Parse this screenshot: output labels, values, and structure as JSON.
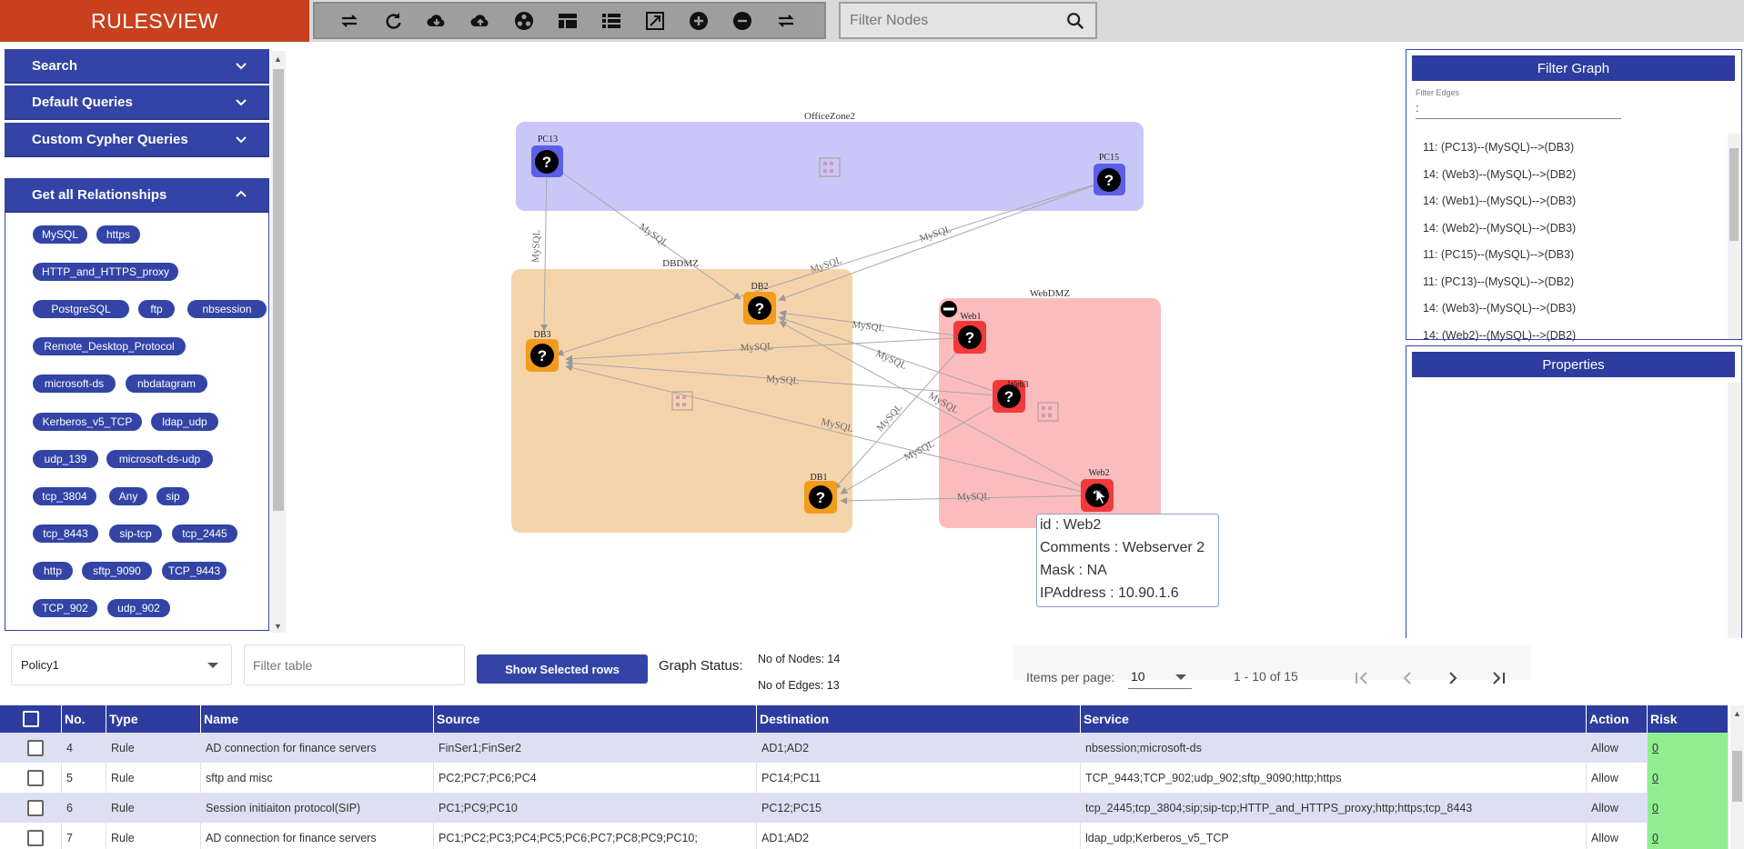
{
  "app": {
    "title": "RULESVIEW"
  },
  "toolbar": {
    "icons": [
      "swap-horizontal-icon",
      "refresh-icon",
      "cloud-download-icon",
      "cloud-upload-icon",
      "cluster-icon",
      "table-layout-icon",
      "list-icon",
      "fullscreen-icon",
      "zoom-in-icon",
      "zoom-out-icon",
      "swap-icon"
    ]
  },
  "filter_nodes": {
    "placeholder": "Filter Nodes"
  },
  "sidebar": {
    "sections": [
      {
        "label": "Search"
      },
      {
        "label": "Default Queries"
      },
      {
        "label": "Custom Cypher Queries"
      },
      {
        "label": "Get all Relationships"
      }
    ],
    "relationships": [
      "MySQL",
      "https",
      "HTTP_and_HTTPS_proxy",
      "PostgreSQL",
      "ftp",
      "nbsession",
      "Remote_Desktop_Protocol",
      "microsoft-ds",
      "nbdatagram",
      "Kerberos_v5_TCP",
      "ldap_udp",
      "udp_139",
      "microsoft-ds-udp",
      "tcp_3804",
      "Any",
      "sip",
      "tcp_8443",
      "sip-tcp",
      "tcp_2445",
      "http",
      "sftp_9090",
      "TCP_9443",
      "TCP_902",
      "udp_902"
    ]
  },
  "graph": {
    "zones": [
      {
        "name": "OfficeZone2"
      },
      {
        "name": "DBDMZ"
      },
      {
        "name": "WebDMZ"
      }
    ],
    "nodes": [
      {
        "id": "PC13"
      },
      {
        "id": "PC15"
      },
      {
        "id": "DB2"
      },
      {
        "id": "DB3"
      },
      {
        "id": "DB1"
      },
      {
        "id": "Web1"
      },
      {
        "id": "Web3"
      },
      {
        "id": "Web2"
      }
    ],
    "edge_label": "MySQL",
    "tooltip": {
      "id": "id : Web2",
      "comments": "Comments : Webserver 2",
      "mask": "Mask : NA",
      "ip": "IPAddress : 10.90.1.6"
    }
  },
  "filter_graph": {
    "title": "Filter Graph",
    "edges_label": "Filter Edges",
    "edges_value": ":",
    "items": [
      "11: (PC13)--(MySQL)-->(DB3)",
      "14: (Web3)--(MySQL)-->(DB2)",
      "14: (Web1)--(MySQL)-->(DB3)",
      "14: (Web2)--(MySQL)-->(DB3)",
      "11: (PC15)--(MySQL)-->(DB3)",
      "11: (PC13)--(MySQL)-->(DB2)",
      "14: (Web3)--(MySQL)-->(DB3)",
      "14: (Web2)--(MySQL)-->(DB2)"
    ]
  },
  "properties": {
    "title": "Properties"
  },
  "controls": {
    "policy": "Policy1",
    "filter_table_placeholder": "Filter table",
    "show_selected": "Show Selected rows",
    "graph_status_label": "Graph Status:",
    "nodes_count": "No of Nodes: 14",
    "edges_count": "No of Edges: 13",
    "items_per_page_label": "Items per page:",
    "items_per_page": "10",
    "range": "1 - 10 of 15"
  },
  "table": {
    "headers": [
      "No.",
      "Type",
      "Name",
      "Source",
      "Destination",
      "Service",
      "Action",
      "Risk"
    ],
    "rows": [
      {
        "no": "4",
        "type": "Rule",
        "name": "AD connection for finance servers",
        "source": "FinSer1;FinSer2",
        "destination": "AD1;AD2",
        "service": "nbsession;microsoft-ds",
        "action": "Allow",
        "risk": "0"
      },
      {
        "no": "5",
        "type": "Rule",
        "name": "sftp and misc",
        "source": "PC2;PC7;PC6;PC4",
        "destination": "PC14;PC11",
        "service": "TCP_9443;TCP_902;udp_902;sftp_9090;http;https",
        "action": "Allow",
        "risk": "0"
      },
      {
        "no": "6",
        "type": "Rule",
        "name": "Session initiaiton protocol(SIP)",
        "source": "PC1;PC9;PC10",
        "destination": "PC12;PC15",
        "service": "tcp_2445;tcp_3804;sip;sip-tcp;HTTP_and_HTTPS_proxy;http;https;tcp_8443",
        "action": "Allow",
        "risk": "0"
      },
      {
        "no": "7",
        "type": "Rule",
        "name": "AD connection for finance servers",
        "source": "PC1;PC2;PC3;PC4;PC5;PC6;PC7;PC8;PC9;PC10;",
        "destination": "AD1;AD2",
        "service": "ldap_udp;Kerberos_v5_TCP",
        "action": "Allow",
        "risk": "0"
      }
    ]
  },
  "colors": {
    "brand": "#c8401c",
    "primary": "#3344a6",
    "header": "#2d3c9e",
    "zone_office": "#c9c7f7",
    "zone_db": "#f5d4ac",
    "zone_web": "#fbbcbe",
    "risk_low": "#90ee90"
  }
}
